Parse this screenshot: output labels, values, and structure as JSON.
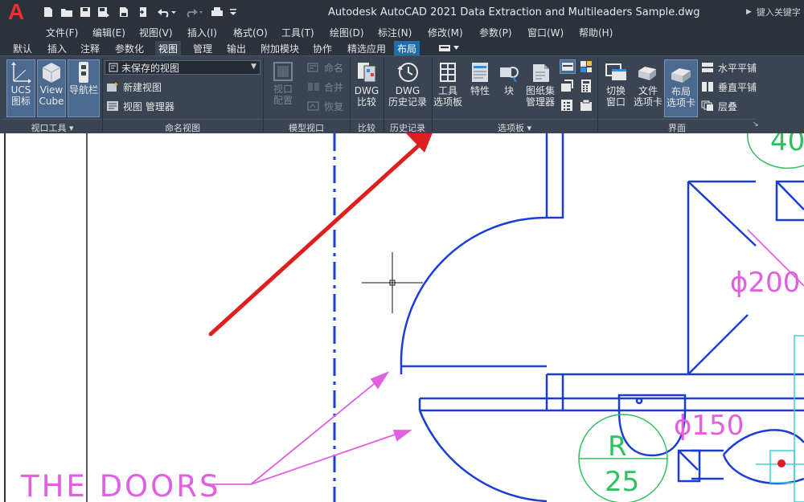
{
  "window": {
    "app_logo": "A",
    "title": "Autodesk AutoCAD 2021    Data Extraction and Multileaders Sample.dwg",
    "search_placeholder": "键入关键字"
  },
  "menu": [
    "文件(F)",
    "编辑(E)",
    "视图(V)",
    "插入(I)",
    "格式(O)",
    "工具(T)",
    "绘图(D)",
    "标注(N)",
    "修改(M)",
    "参数(P)",
    "窗口(W)",
    "帮助(H)"
  ],
  "tabs": {
    "items": [
      "默认",
      "插入",
      "注释",
      "参数化",
      "视图",
      "管理",
      "输出",
      "附加模块",
      "协作",
      "精选应用",
      "布局"
    ],
    "active": "视图",
    "highlighted": "布局"
  },
  "ribbon": {
    "viewport_tools": {
      "title": "视口工具",
      "ucs": [
        "UCS",
        "图标"
      ],
      "viewcube": [
        "View",
        "Cube"
      ],
      "navbar": "导航栏"
    },
    "named_views": {
      "title": "命名视图",
      "select_value": "未保存的视图",
      "new_view": "新建视图",
      "view_manager": "视图 管理器"
    },
    "model_viewports": {
      "title": "模型视口",
      "config": [
        "视口",
        "配置"
      ],
      "name": "命名",
      "join": "合并",
      "restore": "恢复"
    },
    "compare": {
      "title": "比较",
      "dwg_compare": [
        "DWG",
        "比较"
      ]
    },
    "history": {
      "title": "历史记录",
      "dwg_history": [
        "DWG",
        "历史记录"
      ]
    },
    "palettes": {
      "title": "选项板",
      "tool_palettes": [
        "工具",
        "选项板"
      ],
      "properties": "特性",
      "block": "块",
      "sheet_set": [
        "图纸集",
        "管理器"
      ]
    },
    "interface": {
      "title": "界面",
      "switch_windows": [
        "切换",
        "窗口"
      ],
      "file_tabs": [
        "文件",
        "选项卡"
      ],
      "layout_tabs": [
        "布局",
        "选项卡"
      ],
      "tile_horizontal": "水平平铺",
      "tile_vertical": "垂直平铺",
      "cascade": "层叠"
    }
  },
  "drawing": {
    "label": "THE DOORS",
    "dimensions": [
      "40",
      "ϕ200",
      "ϕ150",
      "R",
      "25"
    ]
  },
  "colors": {
    "title_bg": "#2b323c",
    "ribbon_bg": "#3b4453",
    "active_tab": "#3d4655",
    "highlight_tab": "#1e6ea8",
    "drawing_blue": "#1a3dd6",
    "drawing_magenta": "#e060e0",
    "drawing_green": "#30c060",
    "drawing_cyan": "#40d0d0",
    "annotation_arrow": "#dd1f1f"
  }
}
